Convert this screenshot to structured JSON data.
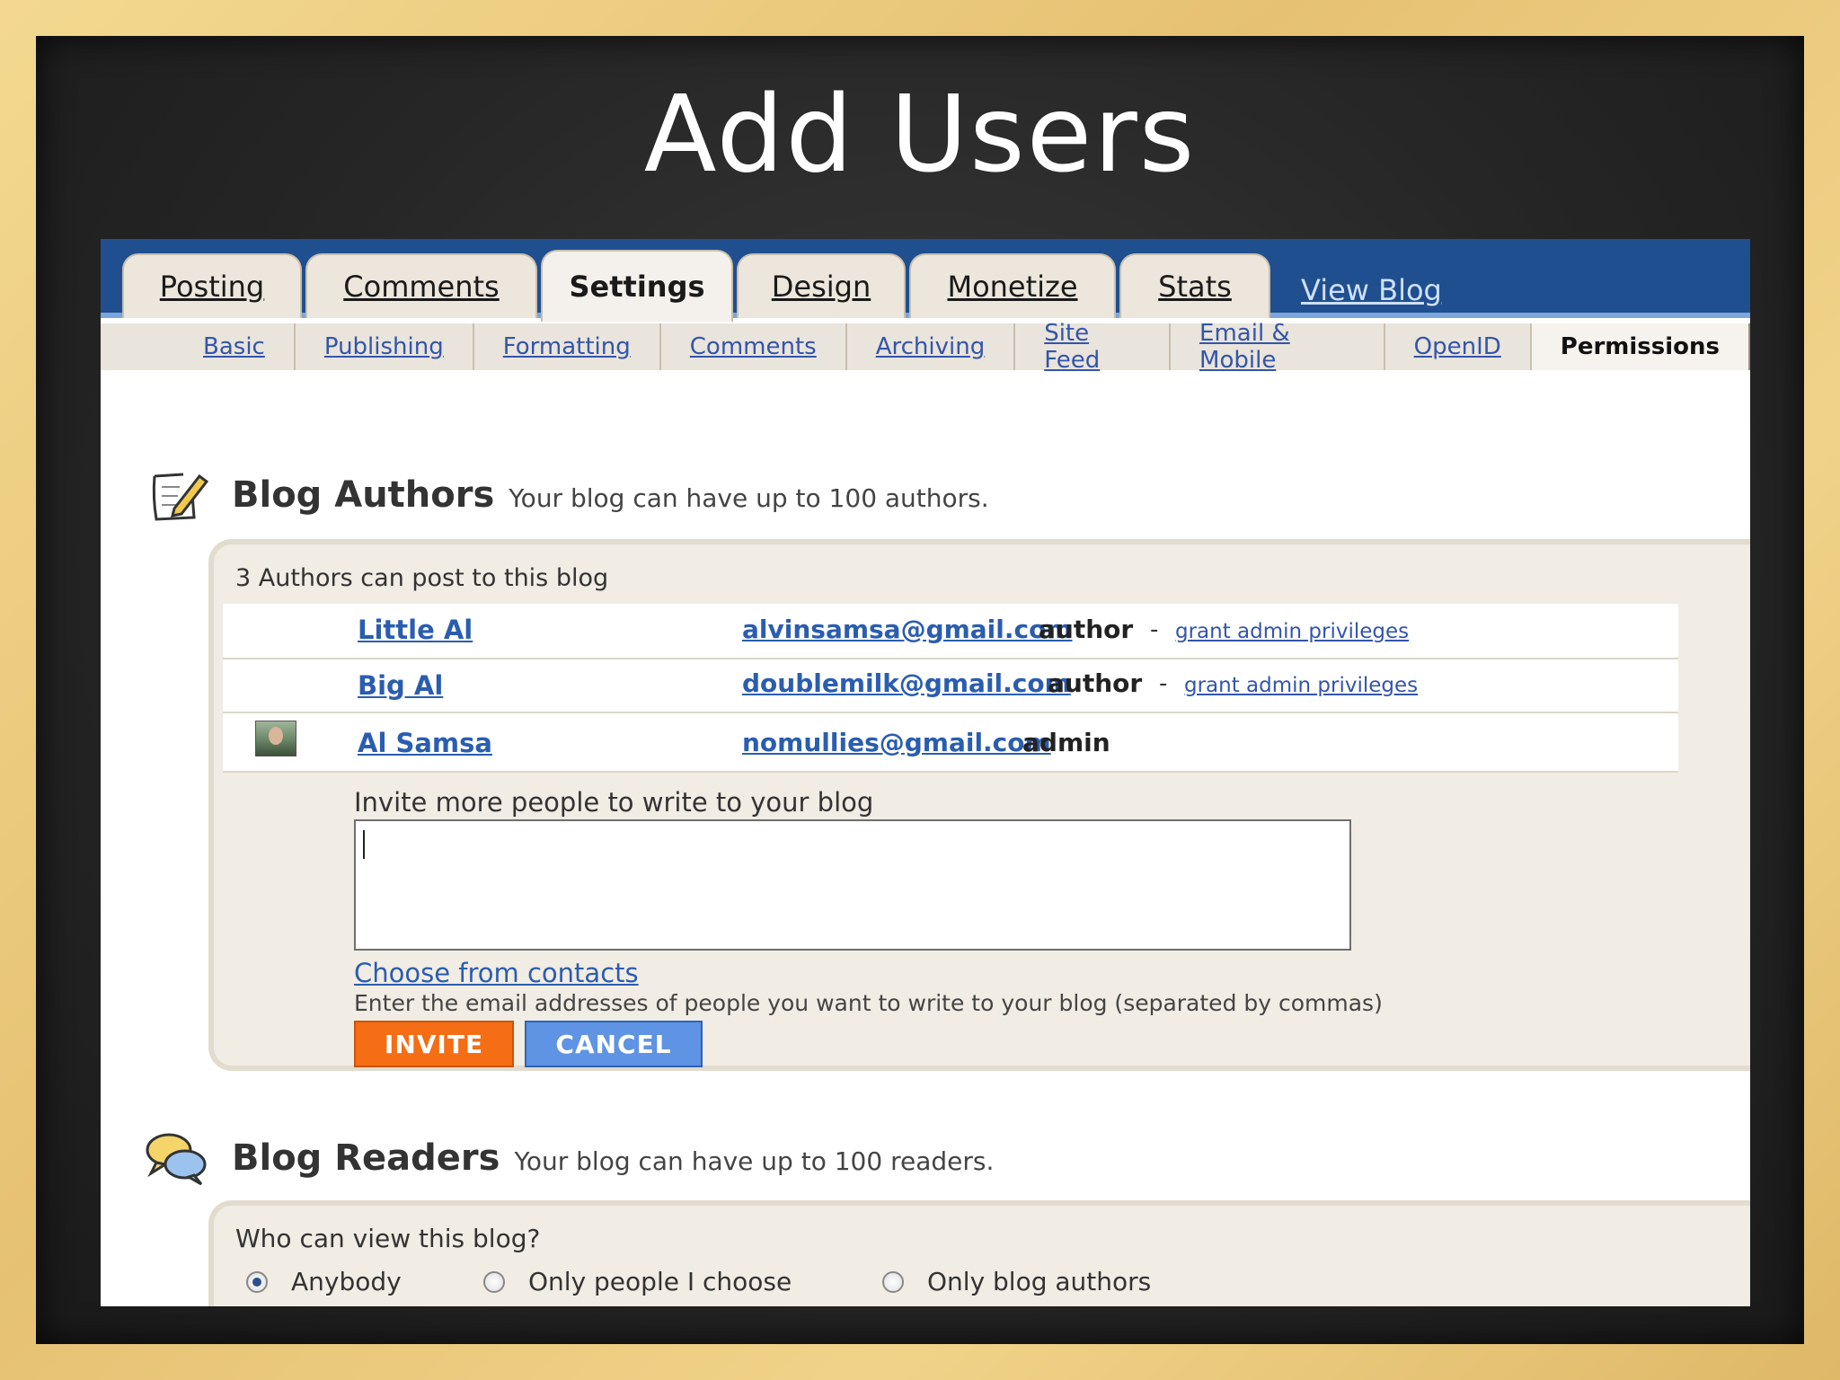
{
  "slide": {
    "title": "Add Users"
  },
  "tabs": [
    {
      "label": "Posting"
    },
    {
      "label": "Comments"
    },
    {
      "label": "Settings"
    },
    {
      "label": "Design"
    },
    {
      "label": "Monetize"
    },
    {
      "label": "Stats"
    }
  ],
  "view_blog": "View Blog",
  "subnav": [
    {
      "label": "Basic"
    },
    {
      "label": "Publishing"
    },
    {
      "label": "Formatting"
    },
    {
      "label": "Comments"
    },
    {
      "label": "Archiving"
    },
    {
      "label": "Site Feed"
    },
    {
      "label": "Email & Mobile"
    },
    {
      "label": "OpenID"
    },
    {
      "label": "Permissions"
    }
  ],
  "authors": {
    "title": "Blog Authors",
    "subtitle": "Your blog can have up to 100 authors.",
    "count_text": "3 Authors can post to this blog",
    "rows": [
      {
        "name": "Little Al",
        "email": "alvinsamsa@gmail.com",
        "role": "author",
        "dash": "-",
        "grant": "grant admin privileges"
      },
      {
        "name": "Big Al",
        "email": "doublemilk@gmail.com",
        "role": "author",
        "dash": "-",
        "grant": "grant admin privileges"
      },
      {
        "name": "Al Samsa",
        "email": "nomullies@gmail.com",
        "role": "admin"
      }
    ],
    "invite_label": "Invite more people to write to your blog",
    "invite_value": "",
    "choose_contacts": "Choose from contacts",
    "hint": "Enter the email addresses of people you want to write to your blog (separated by commas)",
    "invite_button": "INVITE",
    "cancel_button": "CANCEL"
  },
  "readers": {
    "title": "Blog Readers",
    "subtitle": "Your blog can have up to 100 readers.",
    "question": "Who can view this blog?",
    "options": [
      {
        "label": "Anybody",
        "selected": true
      },
      {
        "label": "Only people I choose",
        "selected": false
      },
      {
        "label": "Only blog authors",
        "selected": false
      }
    ]
  }
}
